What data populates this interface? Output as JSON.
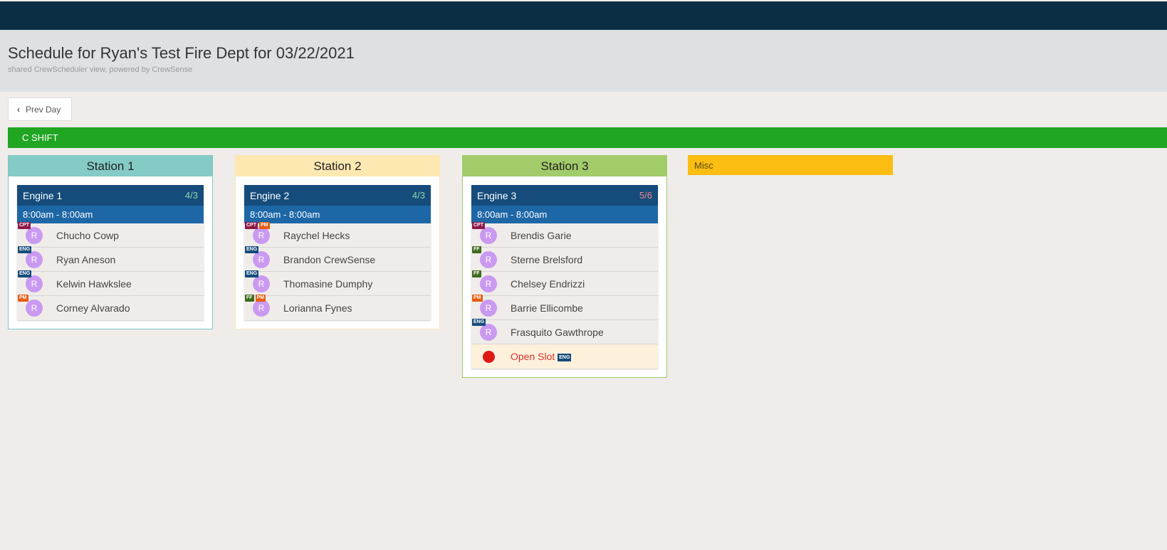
{
  "header": {
    "title": "Schedule for Ryan's Test Fire Dept for 03/22/2021",
    "subtitle": "shared CrewScheduler view, powered by CrewSense"
  },
  "nav": {
    "prev_label": "Prev Day"
  },
  "shift": {
    "label": "C SHIFT"
  },
  "stations": [
    {
      "title": "Station 1",
      "apparatus": {
        "name": "Engine 1",
        "count": "4/3",
        "count_color": "#8fd6a8",
        "time": "8:00am - 8:00am",
        "crew": [
          {
            "initial": "R",
            "name": "Chucho Cowp",
            "badges": [
              "CPT"
            ]
          },
          {
            "initial": "R",
            "name": "Ryan Aneson",
            "badges": [
              "ENG"
            ]
          },
          {
            "initial": "R",
            "name": "Kelwin Hawkslee",
            "badges": [
              "ENG"
            ]
          },
          {
            "initial": "R",
            "name": "Corney Alvarado",
            "badges": [
              "PM"
            ]
          }
        ]
      }
    },
    {
      "title": "Station 2",
      "apparatus": {
        "name": "Engine 2",
        "count": "4/3",
        "count_color": "#8fd6a8",
        "time": "8:00am - 8:00am",
        "crew": [
          {
            "initial": "R",
            "name": "Raychel Hecks",
            "badges": [
              "CPT",
              "PM"
            ]
          },
          {
            "initial": "R",
            "name": "Brandon CrewSense",
            "badges": [
              "ENG"
            ]
          },
          {
            "initial": "R",
            "name": "Thomasine Dumphy",
            "badges": [
              "ENG"
            ]
          },
          {
            "initial": "R",
            "name": "Lorianna Fynes",
            "badges": [
              "FF",
              "PM"
            ]
          }
        ]
      }
    },
    {
      "title": "Station 3",
      "apparatus": {
        "name": "Engine 3",
        "count": "5/6",
        "count_color": "#f08a8a",
        "time": "8:00am - 8:00am",
        "crew": [
          {
            "initial": "R",
            "name": "Brendis Garie",
            "badges": [
              "CPT"
            ]
          },
          {
            "initial": "R",
            "name": "Sterne Brelsford",
            "badges": [
              "FF"
            ]
          },
          {
            "initial": "R",
            "name": "Chelsey Endrizzi",
            "badges": [
              "FF"
            ]
          },
          {
            "initial": "R",
            "name": "Barrie Ellicombe",
            "badges": [
              "PM"
            ]
          },
          {
            "initial": "R",
            "name": "Frasquito Gawthrope",
            "badges": [
              "ENG"
            ]
          }
        ],
        "open_slot": {
          "label": "Open Slot",
          "badge": "ENG"
        }
      }
    }
  ],
  "misc": {
    "label": "Misc"
  },
  "colors": {
    "topbar": "#0b2e45",
    "shift": "#21a623",
    "apparatus_head": "#154c7c",
    "apparatus_time": "#1e67a6"
  }
}
